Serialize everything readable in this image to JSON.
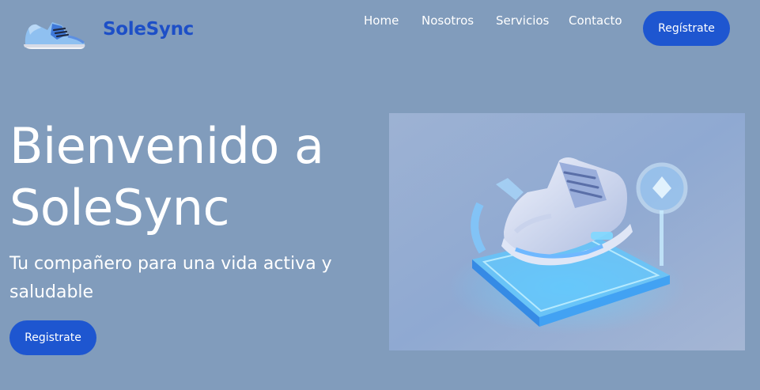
{
  "header": {
    "brand": "SoleSync",
    "logo_icon": "sneaker-logo-icon",
    "nav": [
      "Home",
      "Nosotros",
      "Servicios",
      "Contacto"
    ],
    "cta_label": "Regístrate"
  },
  "hero": {
    "title_line1": "Bienvenido a",
    "title_line2": "SoleSync",
    "subtitle_line1": "Tu compañero para una vida activa y",
    "subtitle_line2": "saludable",
    "cta_label": "Registrate",
    "image_icon": "sneaker-hologram-illustration"
  },
  "colors": {
    "background": "#819cbc",
    "brand": "#1d4fc7",
    "button": "#1e56d0",
    "text": "#ffffff"
  }
}
